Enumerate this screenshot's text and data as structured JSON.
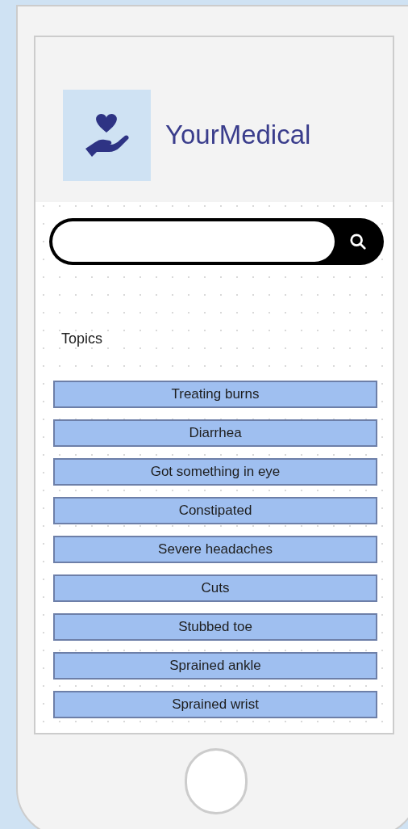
{
  "brand": {
    "name": "YourMedical"
  },
  "topics": {
    "heading": "Topics",
    "items": [
      {
        "label": "Treating burns"
      },
      {
        "label": "Diarrhea"
      },
      {
        "label": "Got something in eye"
      },
      {
        "label": "Constipated"
      },
      {
        "label": "Severe headaches"
      },
      {
        "label": "Cuts"
      },
      {
        "label": "Stubbed toe"
      },
      {
        "label": "Sprained ankle"
      },
      {
        "label": "Sprained wrist"
      }
    ]
  }
}
